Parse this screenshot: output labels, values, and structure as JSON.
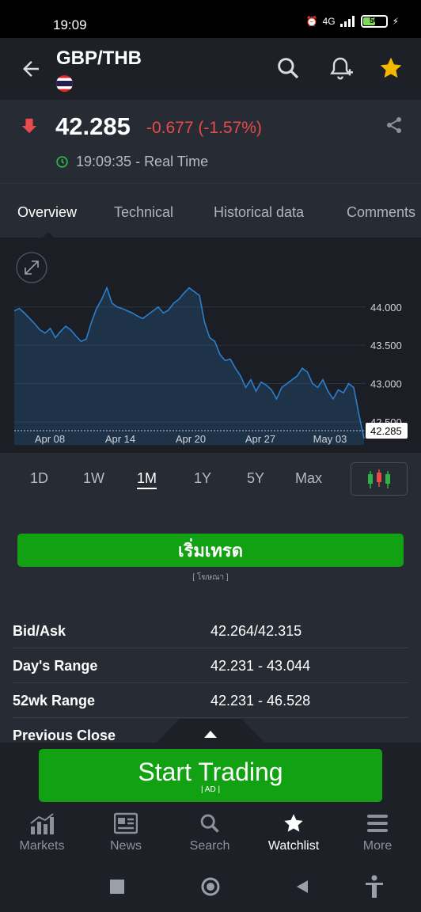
{
  "status_bar": {
    "time": "19:09",
    "battery": "50",
    "network": "4G"
  },
  "header": {
    "title": "GBP/THB"
  },
  "quote": {
    "price": "42.285",
    "change": "-0.677 (-1.57%)",
    "timestamp": "19:09:35 - Real Time"
  },
  "tabs": [
    "Overview",
    "Technical",
    "Historical data",
    "Comments"
  ],
  "chart_data": {
    "type": "area",
    "x_ticks": [
      "Apr 08",
      "Apr 14",
      "Apr 20",
      "Apr 27",
      "May 03"
    ],
    "y_ticks": [
      "44.000",
      "43.500",
      "43.000",
      "42.500"
    ],
    "last_price_label": "42.285",
    "ylim": [
      42.2,
      44.7
    ],
    "values": [
      43.95,
      43.98,
      43.92,
      43.85,
      43.78,
      43.7,
      43.66,
      43.72,
      43.6,
      43.68,
      43.75,
      43.7,
      43.62,
      43.55,
      43.58,
      43.8,
      43.98,
      44.1,
      44.25,
      44.05,
      44.0,
      43.98,
      43.95,
      43.92,
      43.88,
      43.85,
      43.9,
      43.95,
      44.0,
      43.92,
      43.96,
      44.05,
      44.1,
      44.18,
      44.25,
      44.2,
      44.15,
      43.8,
      43.6,
      43.55,
      43.38,
      43.3,
      43.32,
      43.2,
      43.1,
      42.95,
      43.05,
      42.9,
      43.02,
      42.98,
      42.92,
      42.8,
      42.95,
      43.0,
      43.05,
      43.1,
      43.2,
      43.15,
      43.0,
      42.95,
      43.05,
      42.9,
      42.8,
      42.92,
      42.88,
      43.0,
      42.95,
      42.6,
      42.285
    ]
  },
  "ranges": [
    "1D",
    "1W",
    "1M",
    "1Y",
    "5Y",
    "Max"
  ],
  "active_range": "1M",
  "ad_banner": {
    "label": "เริ่มเทรด",
    "tag": "[ โฆษณา ]"
  },
  "stats": [
    {
      "label": "Bid/Ask",
      "value": "42.264/42.315"
    },
    {
      "label": "Day's Range",
      "value": "42.231 - 43.044"
    },
    {
      "label": "52wk Range",
      "value": "42.231 - 46.528"
    },
    {
      "label": "Previous Close",
      "value": ""
    }
  ],
  "cta": {
    "label": "Start Trading",
    "tag": "| AD |"
  },
  "bottom_nav": [
    {
      "label": "Markets",
      "icon": "markets-icon"
    },
    {
      "label": "News",
      "icon": "news-icon"
    },
    {
      "label": "Search",
      "icon": "search-icon"
    },
    {
      "label": "Watchlist",
      "icon": "star-icon"
    },
    {
      "label": "More",
      "icon": "menu-icon"
    }
  ],
  "colors": {
    "accent_green": "#12a112",
    "down_red": "#e84b4b",
    "star_yellow": "#f5b800",
    "chart_line": "#2b7fcf"
  }
}
